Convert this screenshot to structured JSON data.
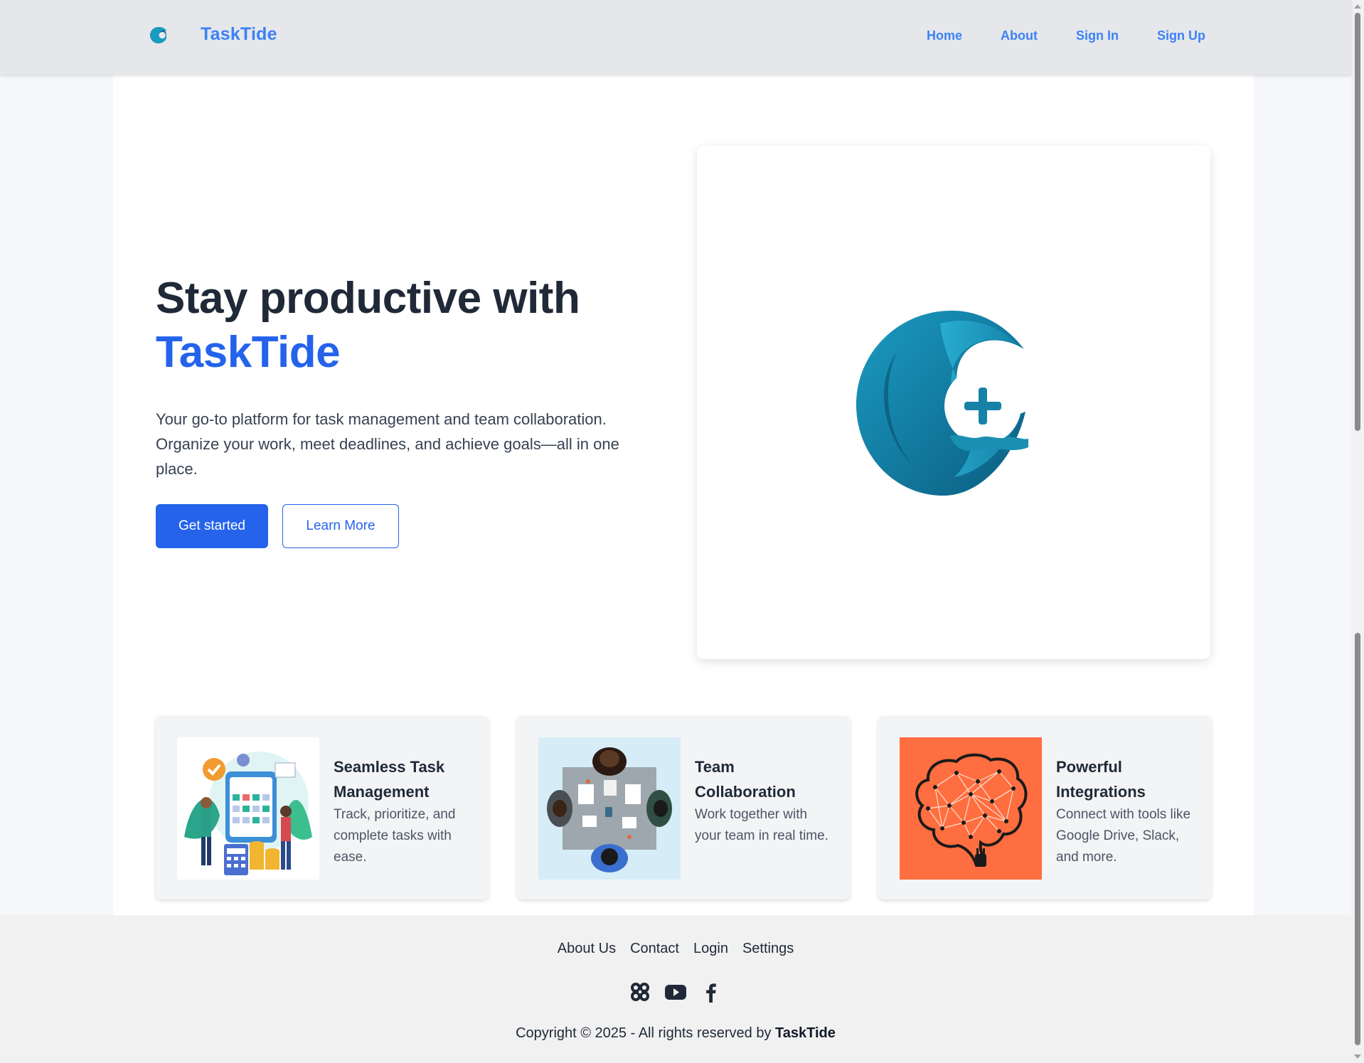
{
  "nav": {
    "brand": "TaskTide",
    "links": [
      "Home",
      "About",
      "Sign In",
      "Sign Up"
    ]
  },
  "hero": {
    "title_line1": "Stay productive with",
    "title_accent": "TaskTide",
    "description": "Your go-to platform for task management and team collaboration. Organize your work, meet deadlines, and achieve goals—all in one place.",
    "primary_button": "Get started",
    "secondary_button": "Learn More"
  },
  "features": [
    {
      "title": "Seamless Task Management",
      "description": "Track, prioritize, and complete tasks with ease.",
      "image": "task-management-illustration"
    },
    {
      "title": "Team Collaboration",
      "description": "Work together with your team in real time.",
      "image": "team-meeting-illustration"
    },
    {
      "title": "Powerful Integrations",
      "description": "Connect with tools like Google Drive, Slack, and more.",
      "image": "brain-network-illustration"
    }
  ],
  "footer": {
    "links": [
      "About Us",
      "Contact",
      "Login",
      "Settings"
    ],
    "social_icons": [
      "clover-icon",
      "youtube-icon",
      "facebook-icon"
    ],
    "copyright_prefix": "Copyright © 2025 - All rights reserved by",
    "copyright_brand": "TaskTide"
  },
  "colors": {
    "brand": "#3b82f6",
    "primary": "#2563eb",
    "logo_teal": "#1a8fb0",
    "integration_orange": "#ff6e40"
  }
}
